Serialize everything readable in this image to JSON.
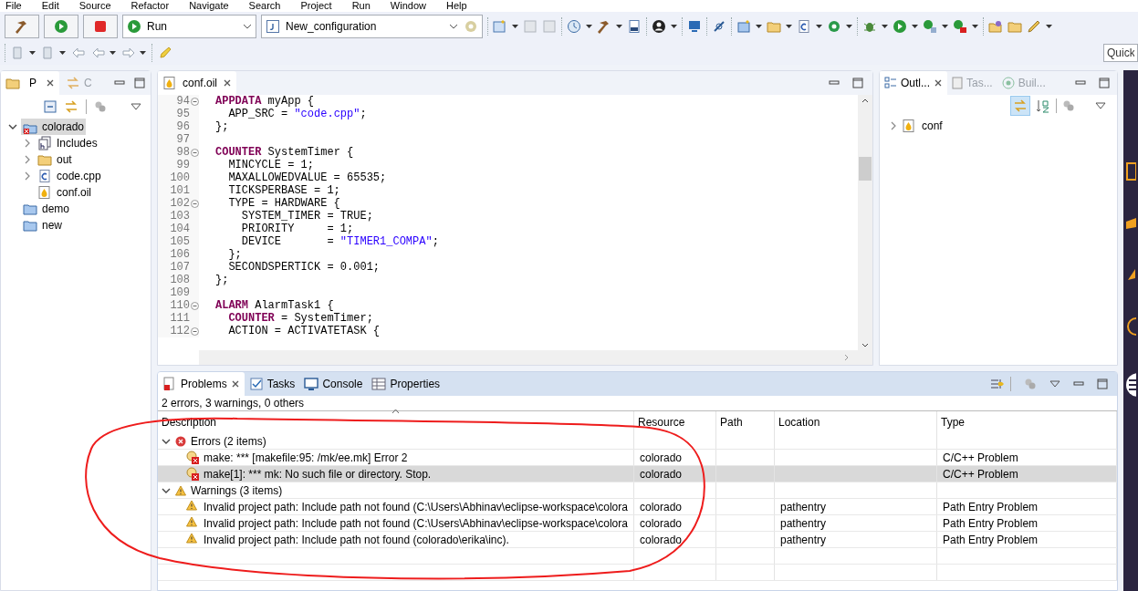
{
  "menu": [
    "File",
    "Edit",
    "Source",
    "Refactor",
    "Navigate",
    "Search",
    "Project",
    "Run",
    "Window",
    "Help"
  ],
  "toolbar": {
    "launch_mode": "Run",
    "launch_configuration": "New_configuration",
    "quick_access": {
      "placeholder": "Quick"
    }
  },
  "project_explorer": {
    "tabs": [
      {
        "label": "P",
        "selected": true
      },
      {
        "label": "C",
        "selected": false
      }
    ],
    "tree": [
      {
        "label": "colorado",
        "kind": "project",
        "expanded": true,
        "selected": true,
        "children": [
          {
            "label": "Includes",
            "kind": "includes",
            "expanded": false,
            "selected": false
          },
          {
            "label": "out",
            "kind": "folder",
            "expanded": false,
            "selected": false
          },
          {
            "label": "code.cpp",
            "kind": "source",
            "expanded": false,
            "selected": false
          },
          {
            "label": "conf.oil",
            "kind": "oil",
            "selected": false
          }
        ]
      },
      {
        "label": "demo",
        "kind": "project-closed",
        "selected": false
      },
      {
        "label": "new",
        "kind": "project-closed",
        "selected": false
      }
    ]
  },
  "editor": {
    "tab": "conf.oil",
    "lines": [
      {
        "number": "94",
        "foldable": true,
        "segments": [
          {
            "kind": "keyword",
            "text": "APPDATA"
          },
          {
            "kind": "plain",
            "text": " myApp {"
          }
        ]
      },
      {
        "number": "95",
        "foldable": false,
        "segments": [
          {
            "kind": "plain",
            "text": "  APP_SRC = "
          },
          {
            "kind": "string",
            "text": "\"code.cpp\""
          },
          {
            "kind": "plain",
            "text": ";"
          }
        ]
      },
      {
        "number": "96",
        "foldable": false,
        "segments": [
          {
            "kind": "plain",
            "text": "};"
          }
        ]
      },
      {
        "number": "97",
        "foldable": false
      },
      {
        "number": "98",
        "foldable": true,
        "segments": [
          {
            "kind": "keyword",
            "text": "COUNTER"
          },
          {
            "kind": "plain",
            "text": " SystemTimer {"
          }
        ]
      },
      {
        "number": "99",
        "foldable": false,
        "segments": [
          {
            "kind": "plain",
            "text": "  MINCYCLE = 1;"
          }
        ]
      },
      {
        "number": "100",
        "foldable": false,
        "segments": [
          {
            "kind": "plain",
            "text": "  MAXALLOWEDVALUE = 65535;"
          }
        ]
      },
      {
        "number": "101",
        "foldable": false,
        "segments": [
          {
            "kind": "plain",
            "text": "  TICKSPERBASE = 1;"
          }
        ]
      },
      {
        "number": "102",
        "foldable": true,
        "segments": [
          {
            "kind": "plain",
            "text": "  TYPE = HARDWARE {"
          }
        ]
      },
      {
        "number": "103",
        "foldable": false,
        "segments": [
          {
            "kind": "plain",
            "text": "    SYSTEM_TIMER = TRUE;"
          }
        ]
      },
      {
        "number": "104",
        "foldable": false,
        "segments": [
          {
            "kind": "plain",
            "text": "    PRIORITY     = 1;"
          }
        ]
      },
      {
        "number": "105",
        "foldable": false,
        "segments": [
          {
            "kind": "plain",
            "text": "    DEVICE       = "
          },
          {
            "kind": "string",
            "text": "\"TIMER1_COMPA\""
          },
          {
            "kind": "plain",
            "text": ";"
          }
        ]
      },
      {
        "number": "106",
        "foldable": false,
        "segments": [
          {
            "kind": "plain",
            "text": "  };"
          }
        ]
      },
      {
        "number": "107",
        "foldable": false,
        "segments": [
          {
            "kind": "plain",
            "text": "  SECONDSPERTICK = 0.001;"
          }
        ]
      },
      {
        "number": "108",
        "foldable": false,
        "segments": [
          {
            "kind": "plain",
            "text": "};"
          }
        ]
      },
      {
        "number": "109",
        "foldable": false
      },
      {
        "number": "110",
        "foldable": true,
        "segments": [
          {
            "kind": "keyword",
            "text": "ALARM"
          },
          {
            "kind": "plain",
            "text": " AlarmTask1 {"
          }
        ]
      },
      {
        "number": "111",
        "foldable": false,
        "segments": [
          {
            "kind": "keyword",
            "text": "  COUNTER"
          },
          {
            "kind": "plain",
            "text": " = SystemTimer;"
          }
        ]
      },
      {
        "number": "112",
        "foldable": true,
        "segments": [
          {
            "kind": "plain",
            "text": "  ACTION = ACTIVATETASK {"
          }
        ]
      }
    ]
  },
  "outline": {
    "tabs": [
      {
        "label": "Outl...",
        "selected": true
      },
      {
        "label": "Tas...",
        "selected": false
      },
      {
        "label": "Buil...",
        "selected": false
      }
    ],
    "tree": [
      {
        "label": "conf",
        "expanded": false
      }
    ]
  },
  "problems": {
    "tabs": [
      {
        "label": "Problems",
        "selected": true
      },
      {
        "label": "Tasks",
        "selected": false
      },
      {
        "label": "Console",
        "selected": false
      },
      {
        "label": "Properties",
        "selected": false
      }
    ],
    "summary": "2 errors, 3 warnings, 0 others",
    "columns": [
      "Description",
      "Resource",
      "Path",
      "Location",
      "Type"
    ],
    "groups": [
      {
        "label": "Errors (2 items)",
        "kind": "error",
        "expanded": true,
        "rows": [
          {
            "description": "make: *** [makefile:95: /mk/ee.mk] Error 2",
            "resource": "colorado",
            "type": "C/C++ Problem",
            "selected": false
          },
          {
            "description": "make[1]: *** mk: No such file or directory.  Stop.",
            "resource": "colorado",
            "type": "C/C++ Problem",
            "selected": true
          }
        ]
      },
      {
        "label": "Warnings (3 items)",
        "kind": "warning",
        "expanded": true,
        "rows": [
          {
            "description": "Invalid project path: Include path not found (C:\\Users\\Abhinav\\eclipse-workspace\\colora",
            "resource": "colorado",
            "location": "pathentry",
            "type": "Path Entry Problem",
            "selected": false
          },
          {
            "description": "Invalid project path: Include path not found (C:\\Users\\Abhinav\\eclipse-workspace\\colora",
            "resource": "colorado",
            "location": "pathentry",
            "type": "Path Entry Problem",
            "selected": false
          },
          {
            "description": "Invalid project path: Include path not found (colorado\\erika\\inc).",
            "resource": "colorado",
            "location": "pathentry",
            "type": "Path Entry Problem",
            "selected": false
          }
        ]
      }
    ]
  }
}
